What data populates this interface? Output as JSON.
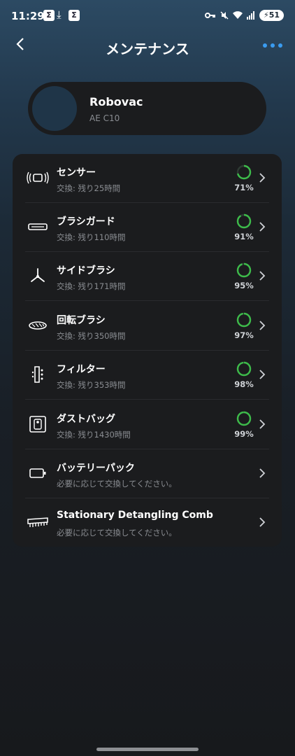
{
  "status_bar": {
    "time": "11:29",
    "notif_icons": [
      "Σ",
      "Σ"
    ],
    "battery": "51"
  },
  "header": {
    "title": "メンテナンス"
  },
  "device": {
    "name": "Robovac",
    "model": "AE C10"
  },
  "items": [
    {
      "icon": "sensor-icon",
      "label": "センサー",
      "sub": "交換: 残り25時間",
      "percent": "71%",
      "value": 0.71
    },
    {
      "icon": "brush-guard-icon",
      "label": "ブラシガード",
      "sub": "交換: 残り110時間",
      "percent": "91%",
      "value": 0.91
    },
    {
      "icon": "side-brush-icon",
      "label": "サイドブラシ",
      "sub": "交換: 残り171時間",
      "percent": "95%",
      "value": 0.95
    },
    {
      "icon": "rolling-brush-icon",
      "label": "回転ブラシ",
      "sub": "交換: 残り350時間",
      "percent": "97%",
      "value": 0.97
    },
    {
      "icon": "filter-icon",
      "label": "フィルター",
      "sub": "交換: 残り353時間",
      "percent": "98%",
      "value": 0.98
    },
    {
      "icon": "dust-bag-icon",
      "label": "ダストバッグ",
      "sub": "交換: 残り1430時間",
      "percent": "99%",
      "value": 0.99
    },
    {
      "icon": "battery-pack-icon",
      "label": "バッテリーパック",
      "sub": "必要に応じて交換してください。"
    },
    {
      "icon": "comb-icon",
      "label": "Stationary Detangling Comb",
      "sub": "必要に応じて交換してください。"
    }
  ],
  "colors": {
    "ring": "#3dbb4a",
    "ring_track": "#2e3a33",
    "accent": "#3a9cf0"
  }
}
